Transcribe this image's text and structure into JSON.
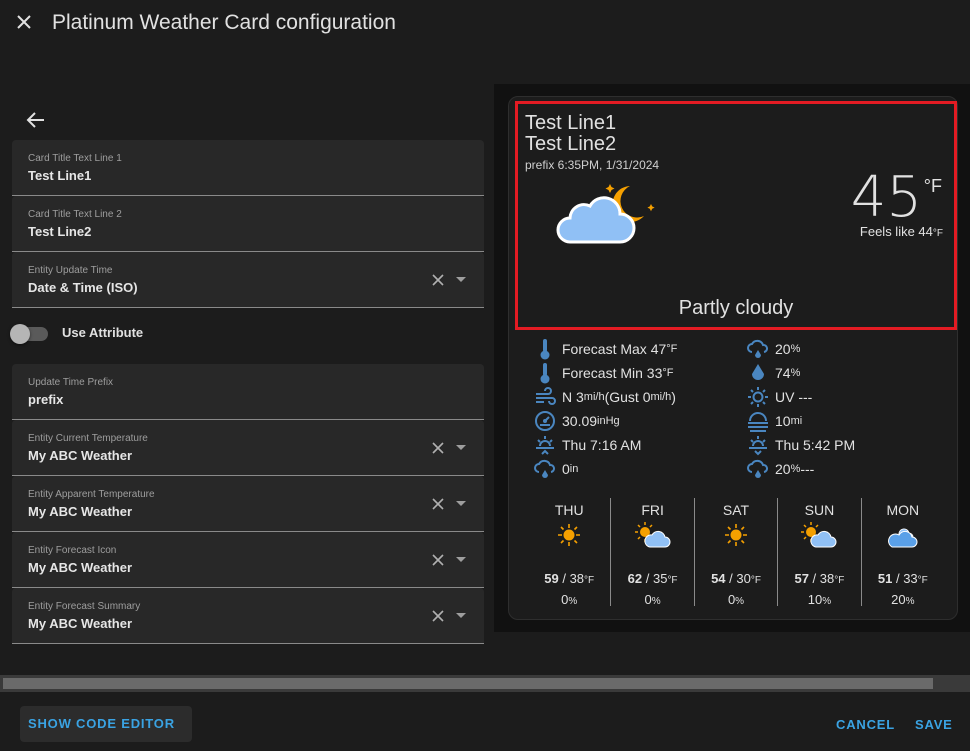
{
  "dialog": {
    "title": "Platinum Weather Card configuration",
    "close_icon": "close-icon",
    "back_icon": "arrow-left-icon"
  },
  "form": {
    "fields": [
      {
        "label": "Card Title Text Line 1",
        "value": "Test Line1",
        "type": "text"
      },
      {
        "label": "Card Title Text Line 2",
        "value": "Test Line2",
        "type": "text"
      },
      {
        "label": "Entity Update Time",
        "value": "Date & Time (ISO)",
        "type": "select"
      }
    ],
    "toggle": {
      "label": "Use Attribute",
      "checked": false
    },
    "fields2": [
      {
        "label": "Update Time Prefix",
        "value": "prefix",
        "type": "text"
      },
      {
        "label": "Entity Current Temperature",
        "value": "My ABC Weather",
        "type": "select"
      },
      {
        "label": "Entity Apparent Temperature",
        "value": "My ABC Weather",
        "type": "select"
      },
      {
        "label": "Entity Forecast Icon",
        "value": "My ABC Weather",
        "type": "select"
      },
      {
        "label": "Entity Forecast Summary",
        "value": "My ABC Weather",
        "type": "select"
      }
    ]
  },
  "preview": {
    "title_line1": "Test Line1",
    "title_line2": "Test Line2",
    "update_time": "prefix 6:35PM, 1/31/2024",
    "condition_icon": "partly-cloudy-night-icon",
    "temperature": "45",
    "temperature_unit": "°F",
    "feels_like_label": "Feels like 44",
    "feels_like_unit": "°F",
    "summary": "Partly cloudy",
    "highlight_color": "#e31b23",
    "attributes_left": [
      {
        "icon": "thermometer-icon",
        "text": "Forecast Max 47",
        "unit": "°F"
      },
      {
        "icon": "thermometer-icon",
        "text": "Forecast Min 33",
        "unit": "°F"
      },
      {
        "icon": "wind-icon",
        "text": "N 3",
        "unit": "mi/h",
        "suffix": " (Gust 0",
        "suffix_unit": "mi/h",
        "end": ")"
      },
      {
        "icon": "gauge-icon",
        "text": "30.09",
        "unit": "inHg"
      },
      {
        "icon": "sunrise-icon",
        "text": "Thu 7:16 AM",
        "unit": ""
      },
      {
        "icon": "rain-cloud-icon",
        "text": "0",
        "unit": "in"
      }
    ],
    "attributes_right": [
      {
        "icon": "rain-cloud-icon",
        "text": "20",
        "unit": "%"
      },
      {
        "icon": "humidity-drop-icon",
        "text": "74",
        "unit": "%"
      },
      {
        "icon": "uv-sun-icon",
        "text": "UV ---",
        "unit": ""
      },
      {
        "icon": "fog-visibility-icon",
        "text": "10",
        "unit": "mi"
      },
      {
        "icon": "sunset-icon",
        "text": "Thu 5:42 PM",
        "unit": ""
      },
      {
        "icon": "rain-cloud-icon",
        "text": "20",
        "unit": "%",
        "suffix": " ---"
      }
    ],
    "forecast": [
      {
        "day": "THU",
        "icon": "sunny-icon",
        "high": "59",
        "low": "38",
        "unit": "°F",
        "precip": "0",
        "precip_unit": "%"
      },
      {
        "day": "FRI",
        "icon": "partly-cloudy-day-icon",
        "high": "62",
        "low": "35",
        "unit": "°F",
        "precip": "0",
        "precip_unit": "%"
      },
      {
        "day": "SAT",
        "icon": "sunny-icon",
        "high": "54",
        "low": "30",
        "unit": "°F",
        "precip": "0",
        "precip_unit": "%"
      },
      {
        "day": "SUN",
        "icon": "partly-cloudy-day-icon",
        "high": "57",
        "low": "38",
        "unit": "°F",
        "precip": "10",
        "precip_unit": "%"
      },
      {
        "day": "MON",
        "icon": "cloudy-icon",
        "high": "51",
        "low": "33",
        "unit": "°F",
        "precip": "20",
        "precip_unit": "%"
      }
    ]
  },
  "footer": {
    "show_code_editor": "SHOW CODE EDITOR",
    "cancel": "CANCEL",
    "save": "SAVE"
  },
  "colors": {
    "accent": "#3aa3e3",
    "icon_blue": "#4a86c0",
    "sun_orange": "#f5a000",
    "cloud_blue": "#90c0f5"
  }
}
